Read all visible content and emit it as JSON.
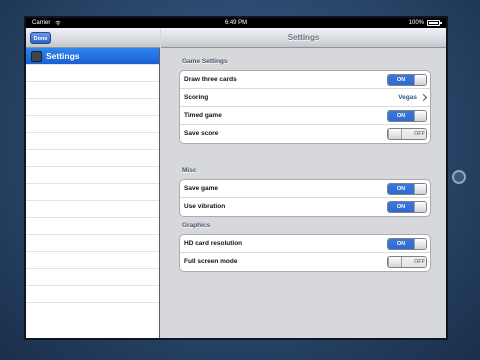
{
  "status_bar": {
    "carrier": "Carrier",
    "time": "6:49 PM",
    "battery": "100%"
  },
  "master": {
    "done_label": "Done",
    "items": [
      {
        "label": "Settings",
        "icon": "settings-app-icon",
        "selected": true
      }
    ]
  },
  "detail": {
    "title": "Settings",
    "sections": [
      {
        "header": "Game Settings",
        "rows": [
          {
            "label": "Draw three cards",
            "control": "switch",
            "on": true,
            "state_text": "ON"
          },
          {
            "label": "Scoring",
            "control": "disclosure",
            "value": "Vegas"
          },
          {
            "label": "Timed game",
            "control": "switch",
            "on": true,
            "state_text": "ON"
          },
          {
            "label": "Save score",
            "control": "switch",
            "on": false,
            "state_text": "OFF"
          }
        ]
      },
      {
        "header": "Misc",
        "rows": [
          {
            "label": "Save game",
            "control": "switch",
            "on": true,
            "state_text": "ON"
          },
          {
            "label": "Use vibration",
            "control": "switch",
            "on": true,
            "state_text": "ON"
          }
        ]
      },
      {
        "header": "Graphics",
        "rows": [
          {
            "label": "HD card resolution",
            "control": "switch",
            "on": true,
            "state_text": "ON"
          },
          {
            "label": "Full screen mode",
            "control": "switch",
            "on": false,
            "state_text": "OFF"
          }
        ]
      }
    ]
  },
  "colors": {
    "accent_blue": "#2e6ad2",
    "selection_blue": "#1a5fd0",
    "background_gray": "#d6d8dc"
  }
}
